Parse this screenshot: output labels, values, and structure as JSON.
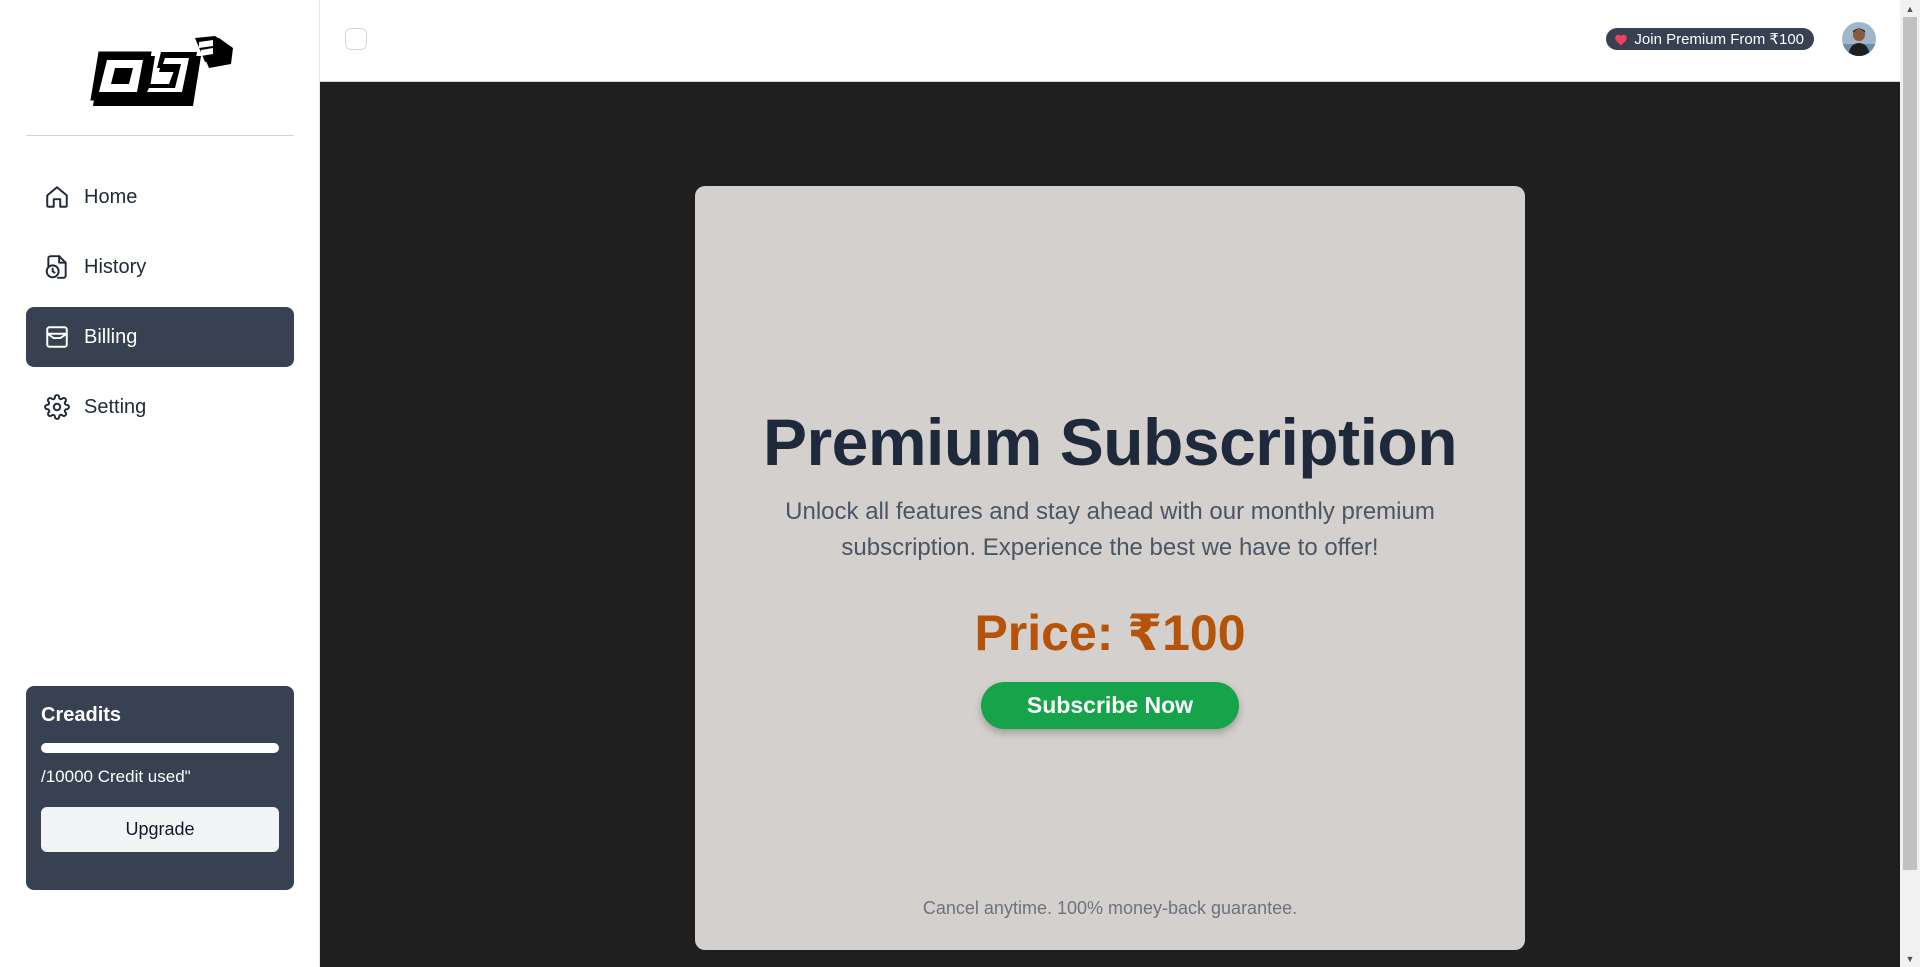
{
  "sidebar": {
    "logo_name": "DJ logo",
    "items": [
      {
        "label": "Home",
        "icon": "home-icon",
        "active": false
      },
      {
        "label": "History",
        "icon": "history-icon",
        "active": false
      },
      {
        "label": "Billing",
        "icon": "billing-icon",
        "active": true
      },
      {
        "label": "Setting",
        "icon": "gear-icon",
        "active": false
      }
    ],
    "credits": {
      "title": "Creadits",
      "used_text": "/10000 Credit used\"",
      "progress_fraction": 0,
      "upgrade_label": "Upgrade"
    }
  },
  "header": {
    "premium_label": "Join Premium From ₹100",
    "premium_icon": "heart-icon"
  },
  "main": {
    "card": {
      "title": "Premium Subscription",
      "description": "Unlock all features and stay ahead with our monthly premium subscription. Experience the best we have to offer!",
      "price": "Price: ₹100",
      "subscribe_label": "Subscribe Now",
      "note": "Cancel anytime. 100% money-back guarantee."
    }
  },
  "colors": {
    "sidebar_active": "#374151",
    "main_bg": "#1f1f1f",
    "card_bg": "#d4d0cd",
    "title": "#1e293b",
    "price": "#b45309",
    "subscribe": "#16a34a"
  }
}
